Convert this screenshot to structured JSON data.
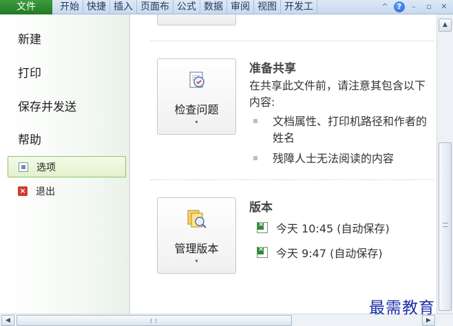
{
  "ribbon": {
    "file_tab": "文件",
    "tabs": [
      "开始",
      "快捷",
      "插入",
      "页面布",
      "公式",
      "数据",
      "审阅",
      "视图",
      "开发工"
    ],
    "collapse_glyph": "^",
    "help_glyph": "?",
    "minimize_glyph": "–",
    "restore_glyph": "▫",
    "close_glyph": "✕"
  },
  "nav": {
    "new": "新建",
    "print": "打印",
    "save_send": "保存并发送",
    "help": "帮助",
    "options": "选项",
    "exit": "退出"
  },
  "inspect": {
    "button_label": "检查问题",
    "title": "准备共享",
    "description": "在共享此文件前，请注意其包含以下内容:",
    "bullets": [
      "文档属性、打印机路径和作者的姓名",
      "残障人士无法阅读的内容"
    ]
  },
  "versions": {
    "button_label": "管理版本",
    "title": "版本",
    "items": [
      "今天 10:45 (自动保存)",
      "今天 9:47 (自动保存)"
    ]
  },
  "icons": {
    "inspect": "inspect-document-icon",
    "manage_versions": "manage-versions-icon",
    "excel_file": "excel-file-icon",
    "options": "options-icon",
    "exit": "exit-icon"
  },
  "colors": {
    "file_tab": "#1f7a24",
    "selected_border": "#8cc26a",
    "watermark": "#1b2ea8"
  },
  "scrollbar": {
    "up_arrow": "▲",
    "down_arrow": "▼",
    "left_arrow": "◀",
    "right_arrow": "▶"
  },
  "caret": "▾",
  "watermark": "最需教育"
}
